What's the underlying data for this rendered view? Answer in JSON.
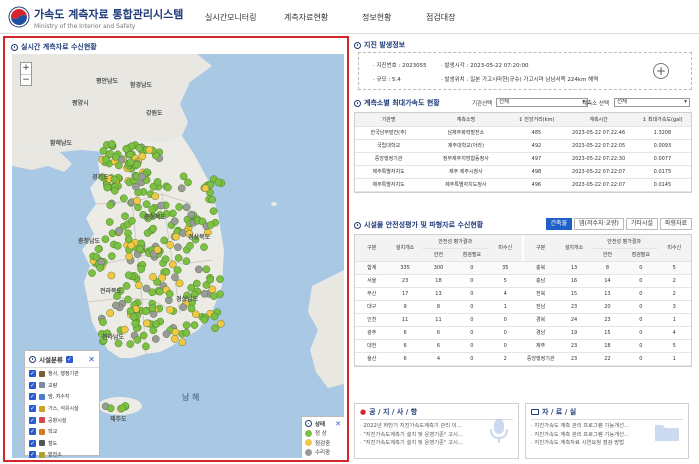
{
  "header": {
    "title": "가속도 계측자료 통합관리시스템",
    "subtitle": "Ministry of the Interior and Safety",
    "nav": [
      "실시간모니터링",
      "계측자료현황",
      "정보현황",
      "점검대장"
    ]
  },
  "map_panel": {
    "title": "실시간 계측자료 수신현황",
    "labels": [
      "평안남도",
      "평양시",
      "함경남도",
      "강원도",
      "황해남도",
      "경기도",
      "충청북도",
      "경상북도",
      "충청남도",
      "전라북도",
      "경상남도",
      "전라남도",
      "제주도",
      "남 해"
    ],
    "zoom": [
      "+",
      "−"
    ],
    "legend": {
      "title": "시설분류",
      "items": [
        {
          "label": "청사, 행정기관",
          "icon": "government-building-icon",
          "color": "#7a5b3c"
        },
        {
          "label": "교량",
          "icon": "bridge-icon",
          "color": "#7c8aa8"
        },
        {
          "label": "댐, 저수지",
          "icon": "dam-icon",
          "color": "#4a7fc4"
        },
        {
          "label": "가스, 석유시설",
          "icon": "gas-facility-icon",
          "color": "#c9a227"
        },
        {
          "label": "공항시설",
          "icon": "airport-icon",
          "color": "#d24a4a"
        },
        {
          "label": "학교",
          "icon": "school-icon",
          "color": "#d37b2a"
        },
        {
          "label": "철도",
          "icon": "railway-icon",
          "color": "#555555"
        },
        {
          "label": "발전소",
          "icon": "power-plant-icon",
          "color": "#b0a030"
        },
        {
          "label": "정거래시설",
          "icon": "facility-icon",
          "color": "#8a4ab0"
        }
      ]
    },
    "status": {
      "title": "상태",
      "items": [
        {
          "label": "정 상",
          "color": "#7bc043"
        },
        {
          "label": "점검중",
          "color": "#f2c744"
        },
        {
          "label": "수리중",
          "color": "#9a9a9a"
        }
      ]
    }
  },
  "quake": {
    "title": "지진 발생정보",
    "quake_id_label": "· 지진번호 : 2023055",
    "time_label": "· 발생시각 : 2023-05-22 07:20:00",
    "magnitude_label": "· 규모 : 5.4",
    "location_label": "· 발생위치 : 일본 가고시마현(규슈) 가고시마 남남서쪽 224km 해역",
    "add_symbol": "+"
  },
  "accel": {
    "title": "계측소별 최대가속도 현황",
    "org_filter_label": "기관선택",
    "org_filter_value": "전체",
    "station_filter_label": "계측소 선택",
    "station_filter_value": "전체",
    "columns": [
      "기관명",
      "계측소명",
      "↕ 진앙거리(km)",
      "계측시간",
      "↕ 최대가속도(gal)"
    ],
    "rows": [
      [
        "한국남부발전(주)",
        "남제주화력발전소",
        "485",
        "2023-05-22 07:22:46",
        "1.3208"
      ],
      [
        "국립대학교",
        "제주대학교(아라)",
        "492",
        "2023-05-22 07:22:05",
        "0.0093"
      ],
      [
        "중앙행정기관",
        "정부제주지방합동청사",
        "497",
        "2023-05-22 07:22:30",
        "0.0077"
      ],
      [
        "제주특별자치도",
        "제주 제주시청사",
        "498",
        "2023-05-22 07:22:07",
        "0.0175"
      ],
      [
        "제주특별자치도",
        "제주특별자치도청사",
        "496",
        "2023-05-22 07:22:07",
        "0.0145"
      ]
    ]
  },
  "safety": {
    "title": "시설물 안전성평가 및 파형자료 수신현황",
    "tabs": [
      "건축물",
      "댐(저수지·교량)",
      "기타시설",
      "파형자료"
    ],
    "col_region": "구분",
    "col_count": "설치개소",
    "col_eval": "안전성 평가결과",
    "col_safe": "안전",
    "col_check": "점검필요",
    "col_none": "미수신",
    "left_rows": [
      [
        "합계",
        "335",
        "300",
        "0",
        "35"
      ],
      [
        "서울",
        "23",
        "18",
        "0",
        "5"
      ],
      [
        "부산",
        "17",
        "13",
        "0",
        "4"
      ],
      [
        "대구",
        "9",
        "8",
        "0",
        "1"
      ],
      [
        "인천",
        "11",
        "11",
        "0",
        "0"
      ],
      [
        "광주",
        "6",
        "6",
        "0",
        "0"
      ],
      [
        "대전",
        "6",
        "6",
        "0",
        "0"
      ],
      [
        "울산",
        "6",
        "4",
        "0",
        "2"
      ]
    ],
    "right_rows": [
      [
        "충북",
        "13",
        "8",
        "0",
        "5"
      ],
      [
        "충남",
        "16",
        "14",
        "0",
        "2"
      ],
      [
        "전북",
        "15",
        "13",
        "0",
        "2"
      ],
      [
        "전남",
        "23",
        "20",
        "0",
        "3"
      ],
      [
        "경북",
        "24",
        "23",
        "0",
        "1"
      ],
      [
        "경남",
        "19",
        "15",
        "0",
        "4"
      ],
      [
        "제주",
        "23",
        "18",
        "0",
        "5"
      ],
      [
        "중앙행정기관",
        "23",
        "22",
        "0",
        "1"
      ]
    ]
  },
  "notice": {
    "title": "공 / 지 / 사 / 항",
    "items": [
      "· 2022년 하반기 지진가속도계측기 관리 이...",
      "· \"지진가속도계측기 설치 및 운영기준\" 고시...",
      "· \"지진가속도계측기 설치 및 운영기준\" 고시..."
    ]
  },
  "data_room": {
    "title": "자 / 료 / 실",
    "items": [
      "· 지진가속도 계측 관리 프로그램 기능개선...",
      "· 지진가속도 계측 관리 프로그램 기능개선...",
      "· 지진가속도 계측자료 시연요청 점검 방법"
    ]
  }
}
